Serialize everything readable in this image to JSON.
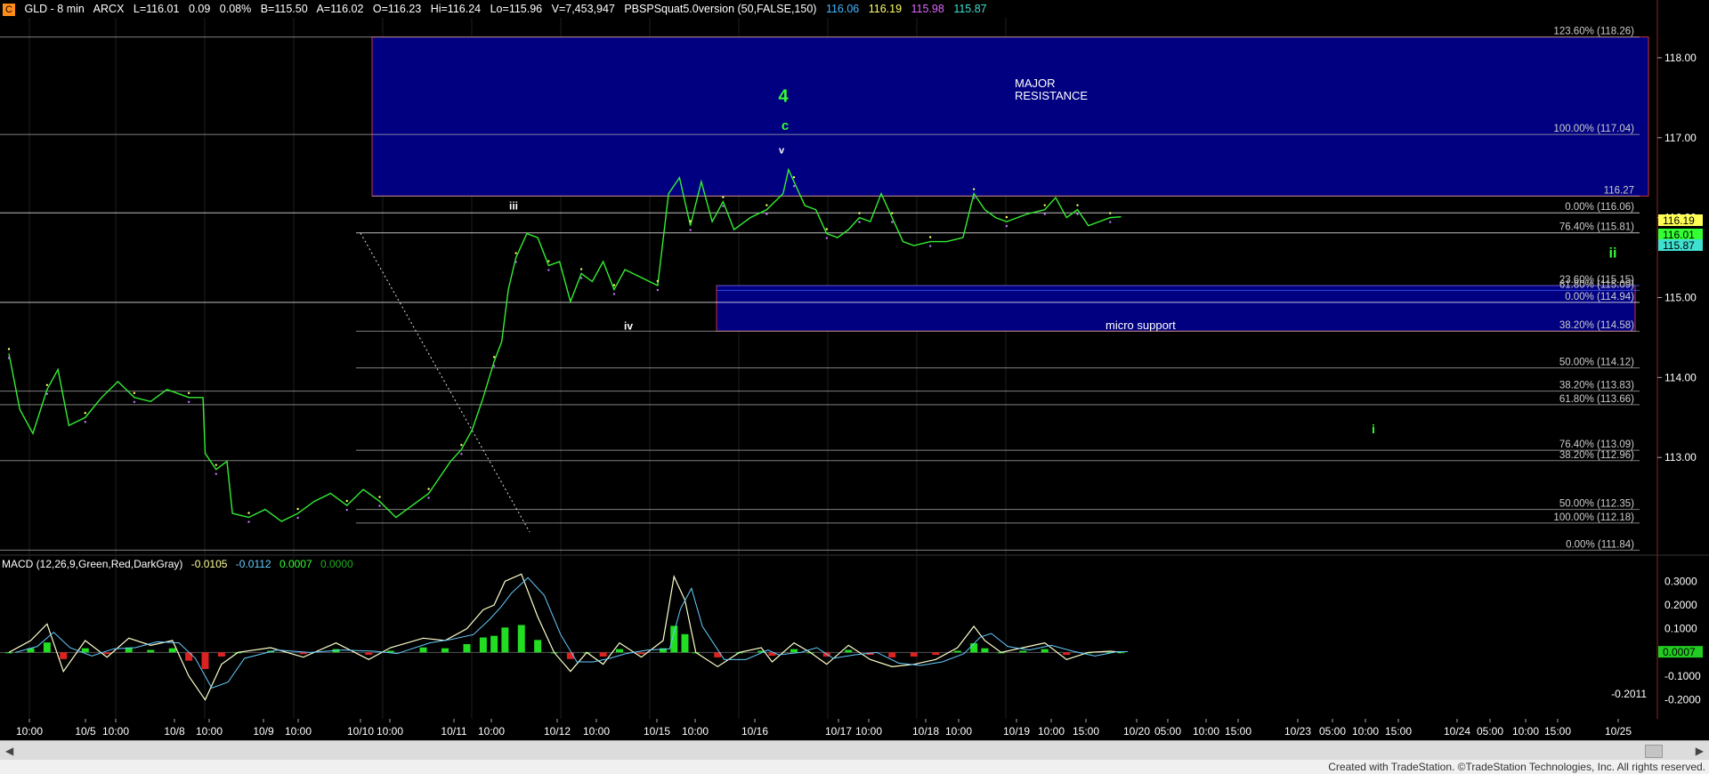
{
  "header": {
    "icon": "C",
    "symbol": "GLD - 8 min",
    "exchange": "ARCX",
    "last": "L=116.01",
    "change": "0.09",
    "pct": "0.08%",
    "bid": "B=115.50",
    "ask": "A=116.02",
    "open": "O=116.23",
    "high": "Hi=116.24",
    "low": "Lo=115.96",
    "volume": "V=7,453,947",
    "indicator": "PBSPSquat5.0version (50,FALSE,150)",
    "ind_values": [
      "116.06",
      "116.19",
      "115.98",
      "115.87"
    ],
    "ind_colors": [
      "#45b6ff",
      "#ffff66",
      "#dd66ff",
      "#40e0d0"
    ]
  },
  "macd_header": {
    "label": "MACD (12,26,9,Green,Red,DarkGray)",
    "values": [
      "-0.0105",
      "-0.0112",
      "0.0007",
      "0.0000"
    ],
    "colors": [
      "#ffff99",
      "#66ccff",
      "#33ff33",
      "#22aa22"
    ]
  },
  "footer": "Created with TradeStation. ©TradeStation Technologies, Inc. All rights reserved.",
  "chart_data": {
    "type": "line",
    "title": "GLD - 8 min",
    "price_axis": {
      "min": 111.8,
      "max": 118.5,
      "ticks": [
        113.0,
        114.0,
        115.0,
        116.0,
        117.0,
        118.0
      ]
    },
    "time_axis_labels": [
      "10:00",
      "10/5",
      "10:00",
      "10/8",
      "10:00",
      "10/9",
      "10:00",
      "10/10",
      "10:00",
      "10/11",
      "10:00",
      "10/12",
      "10:00",
      "10/15",
      "10:00",
      "10/16",
      "10/17",
      "10:00",
      "10/18",
      "10:00",
      "10/19",
      "10:00",
      "15:00",
      "10/20",
      "05:00",
      "10:00",
      "15:00",
      "10/23",
      "05:00",
      "10:00",
      "15:00",
      "10/24",
      "05:00",
      "10:00",
      "15:00",
      "10/25"
    ],
    "price_path": [
      [
        0,
        114.3
      ],
      [
        10,
        113.6
      ],
      [
        22,
        113.3
      ],
      [
        35,
        113.85
      ],
      [
        45,
        114.1
      ],
      [
        55,
        113.4
      ],
      [
        70,
        113.5
      ],
      [
        85,
        113.75
      ],
      [
        100,
        113.95
      ],
      [
        115,
        113.75
      ],
      [
        130,
        113.7
      ],
      [
        145,
        113.85
      ],
      [
        165,
        113.75
      ],
      [
        178,
        113.75
      ],
      [
        180,
        113.05
      ],
      [
        190,
        112.85
      ],
      [
        200,
        112.95
      ],
      [
        205,
        112.3
      ],
      [
        220,
        112.25
      ],
      [
        235,
        112.35
      ],
      [
        250,
        112.2
      ],
      [
        265,
        112.3
      ],
      [
        280,
        112.45
      ],
      [
        295,
        112.55
      ],
      [
        310,
        112.4
      ],
      [
        325,
        112.6
      ],
      [
        330,
        112.55
      ],
      [
        340,
        112.45
      ],
      [
        355,
        112.25
      ],
      [
        370,
        112.4
      ],
      [
        385,
        112.55
      ],
      [
        395,
        112.75
      ],
      [
        405,
        112.95
      ],
      [
        415,
        113.1
      ],
      [
        425,
        113.35
      ],
      [
        435,
        113.75
      ],
      [
        445,
        114.2
      ],
      [
        452,
        114.45
      ],
      [
        458,
        115.1
      ],
      [
        465,
        115.5
      ],
      [
        475,
        115.8
      ],
      [
        485,
        115.75
      ],
      [
        495,
        115.4
      ],
      [
        505,
        115.45
      ],
      [
        515,
        114.95
      ],
      [
        525,
        115.3
      ],
      [
        535,
        115.2
      ],
      [
        545,
        115.45
      ],
      [
        555,
        115.1
      ],
      [
        565,
        115.35
      ],
      [
        580,
        115.25
      ],
      [
        595,
        115.15
      ],
      [
        605,
        116.3
      ],
      [
        615,
        116.5
      ],
      [
        625,
        115.9
      ],
      [
        635,
        116.45
      ],
      [
        645,
        115.95
      ],
      [
        655,
        116.2
      ],
      [
        665,
        115.85
      ],
      [
        680,
        116.0
      ],
      [
        695,
        116.1
      ],
      [
        710,
        116.3
      ],
      [
        715,
        116.6
      ],
      [
        720,
        116.45
      ],
      [
        730,
        116.15
      ],
      [
        740,
        116.1
      ],
      [
        750,
        115.8
      ],
      [
        760,
        115.75
      ],
      [
        770,
        115.85
      ],
      [
        780,
        116.0
      ],
      [
        790,
        115.95
      ],
      [
        800,
        116.3
      ],
      [
        810,
        116.0
      ],
      [
        820,
        115.7
      ],
      [
        830,
        115.65
      ],
      [
        845,
        115.7
      ],
      [
        860,
        115.7
      ],
      [
        875,
        115.75
      ],
      [
        885,
        116.3
      ],
      [
        895,
        116.1
      ],
      [
        905,
        116.0
      ],
      [
        915,
        115.95
      ],
      [
        925,
        116.0
      ],
      [
        935,
        116.05
      ],
      [
        950,
        116.1
      ],
      [
        960,
        116.25
      ],
      [
        970,
        116.0
      ],
      [
        980,
        116.1
      ],
      [
        990,
        115.9
      ],
      [
        1000,
        115.95
      ],
      [
        1010,
        116.0
      ],
      [
        1020,
        116.01
      ]
    ],
    "fib_levels": [
      {
        "label": "123.60% (118.26)",
        "value": 118.26
      },
      {
        "label": "100.00% (117.04)",
        "value": 117.04
      },
      {
        "label": "116.27",
        "value": 116.27
      },
      {
        "label": "0.00% (116.06)",
        "value": 116.06
      },
      {
        "label": "76.40% (115.81)",
        "value": 115.81
      },
      {
        "label": "23.60% (115.15)",
        "value": 115.15
      },
      {
        "label": "61.80% (115.09)",
        "value": 115.09
      },
      {
        "label": "0.00% (114.94)",
        "value": 114.94
      },
      {
        "label": "38.20% (114.58)",
        "value": 114.58
      },
      {
        "label": "50.00% (114.12)",
        "value": 114.12
      },
      {
        "label": "38.20% (113.83)",
        "value": 113.83
      },
      {
        "label": "61.80% (113.66)",
        "value": 113.66
      },
      {
        "label": "76.40% (113.09)",
        "value": 113.09
      },
      {
        "label": "38.20% (112.96)",
        "value": 112.96
      },
      {
        "label": "50.00% (112.35)",
        "value": 112.35
      },
      {
        "label": "100.00% (112.18)",
        "value": 112.18
      },
      {
        "label": "0.00% (111.84)",
        "value": 111.84
      }
    ],
    "zones": [
      {
        "label": "MAJOR RESISTANCE",
        "low": 116.27,
        "high": 118.26
      },
      {
        "label": "micro support",
        "low": 114.58,
        "high": 115.15
      }
    ],
    "wave_labels": [
      {
        "text": "4",
        "price": 117.45,
        "color": "#33ff33"
      },
      {
        "text": "c",
        "price": 117.1,
        "color": "#33ff33"
      },
      {
        "text": "v",
        "price": 116.8,
        "color": "#ffffff"
      },
      {
        "text": "iii",
        "price": 116.1,
        "color": "#ffffff"
      },
      {
        "text": "iv",
        "price": 114.6,
        "color": "#ffffff"
      },
      {
        "text": "ii",
        "price": 115.5,
        "color": "#33ff33"
      },
      {
        "text": "i",
        "price": 113.3,
        "color": "#33ff33"
      }
    ],
    "price_tags": [
      {
        "text": "116.19",
        "color": "#ffff55"
      },
      {
        "text": "116.01",
        "color": "#33ff33"
      },
      {
        "text": "115.87",
        "color": "#40e0d0"
      }
    ],
    "macd": {
      "ticks": [
        "0.3000",
        "0.2000",
        "0.1000",
        "0.0007",
        "-0.1000",
        "-0.2000"
      ],
      "value_min": -0.25,
      "value_max": 0.35,
      "min_label": "-0.2011",
      "macd_line": [
        [
          0,
          0.0
        ],
        [
          20,
          0.05
        ],
        [
          35,
          0.12
        ],
        [
          50,
          -0.08
        ],
        [
          70,
          0.05
        ],
        [
          90,
          -0.02
        ],
        [
          110,
          0.06
        ],
        [
          130,
          0.03
        ],
        [
          150,
          0.05
        ],
        [
          165,
          -0.1
        ],
        [
          180,
          -0.2
        ],
        [
          195,
          -0.05
        ],
        [
          210,
          0.0
        ],
        [
          240,
          0.02
        ],
        [
          270,
          -0.02
        ],
        [
          300,
          0.04
        ],
        [
          330,
          -0.03
        ],
        [
          350,
          0.02
        ],
        [
          380,
          0.06
        ],
        [
          400,
          0.05
        ],
        [
          420,
          0.1
        ],
        [
          435,
          0.18
        ],
        [
          445,
          0.2
        ],
        [
          455,
          0.3
        ],
        [
          470,
          0.33
        ],
        [
          485,
          0.15
        ],
        [
          500,
          0.0
        ],
        [
          515,
          -0.08
        ],
        [
          530,
          0.0
        ],
        [
          545,
          -0.05
        ],
        [
          560,
          0.04
        ],
        [
          580,
          -0.02
        ],
        [
          600,
          0.05
        ],
        [
          610,
          0.32
        ],
        [
          620,
          0.22
        ],
        [
          630,
          0.0
        ],
        [
          650,
          -0.06
        ],
        [
          670,
          0.0
        ],
        [
          690,
          0.02
        ],
        [
          700,
          -0.04
        ],
        [
          720,
          0.04
        ],
        [
          735,
          0.0
        ],
        [
          750,
          -0.05
        ],
        [
          770,
          0.03
        ],
        [
          790,
          -0.03
        ],
        [
          810,
          -0.06
        ],
        [
          830,
          -0.05
        ],
        [
          850,
          -0.03
        ],
        [
          870,
          0.02
        ],
        [
          885,
          0.11
        ],
        [
          895,
          0.05
        ],
        [
          910,
          0.0
        ],
        [
          930,
          0.02
        ],
        [
          950,
          0.04
        ],
        [
          970,
          -0.03
        ],
        [
          990,
          0.0
        ],
        [
          1010,
          0.005
        ],
        [
          1020,
          0.001
        ]
      ]
    }
  }
}
